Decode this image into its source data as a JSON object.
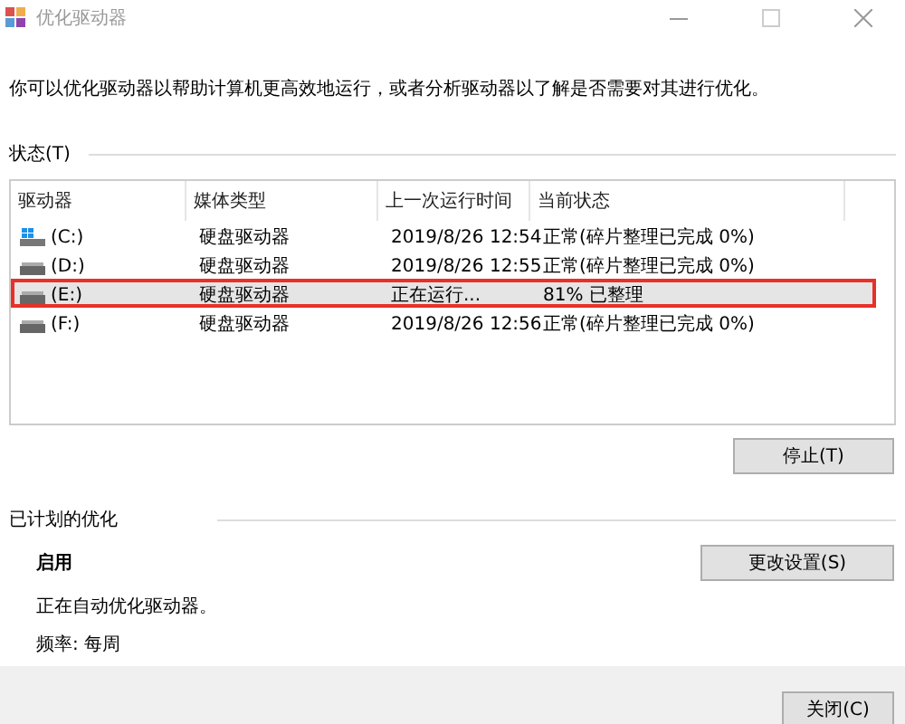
{
  "window": {
    "title": "优化驱动器"
  },
  "description": "你可以优化驱动器以帮助计算机更高效地运行，或者分析驱动器以了解是否需要对其进行优化。",
  "status_section": {
    "label": "状态(T)"
  },
  "table": {
    "columns": [
      "驱动器",
      "媒体类型",
      "上一次运行时间",
      "当前状态"
    ],
    "rows": [
      {
        "kind": "system",
        "drive": "(C:)",
        "media": "硬盘驱动器",
        "last_run": "2019/8/26 12:54",
        "status": "正常(碎片整理已完成 0%)",
        "selected": false,
        "highlighted": false
      },
      {
        "kind": "disk",
        "drive": "(D:)",
        "media": "硬盘驱动器",
        "last_run": "2019/8/26 12:55",
        "status": "正常(碎片整理已完成 0%)",
        "selected": false,
        "highlighted": false
      },
      {
        "kind": "disk",
        "drive": "(E:)",
        "media": "硬盘驱动器",
        "last_run": "正在运行...",
        "status": "81% 已整理",
        "selected": true,
        "highlighted": true
      },
      {
        "kind": "disk",
        "drive": "(F:)",
        "media": "硬盘驱动器",
        "last_run": "2019/8/26 12:56",
        "status": "正常(碎片整理已完成 0%)",
        "selected": false,
        "highlighted": false
      }
    ]
  },
  "stop_button": "停止(T)",
  "schedule": {
    "label": "已计划的优化",
    "state": "启用",
    "description": "正在自动优化驱动器。",
    "frequency": "频率: 每周",
    "button": "更改设置(S)"
  },
  "close_button": "关闭(C)"
}
